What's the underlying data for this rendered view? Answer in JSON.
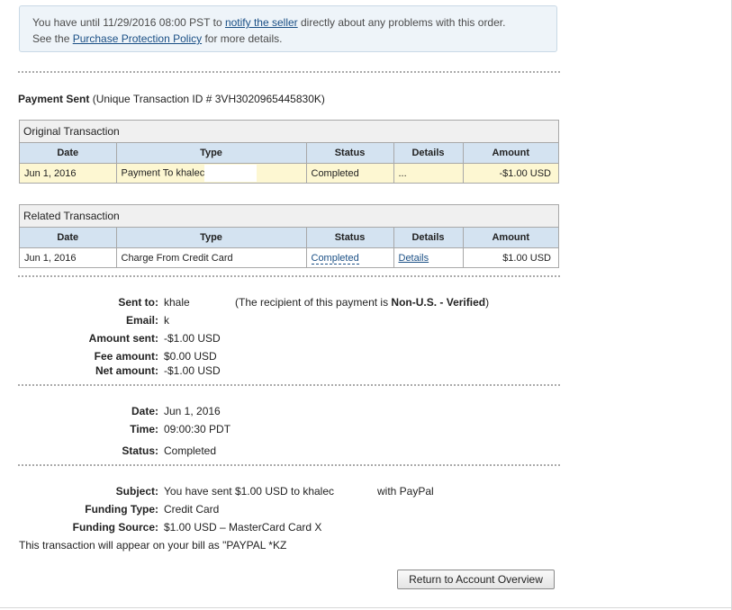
{
  "notice": {
    "line1_before": "You have until 11/29/2016 08:00 PST to ",
    "line1_link": "notify the seller",
    "line1_after": " directly about any problems with this order.",
    "line2_before": "See the ",
    "line2_link": "Purchase Protection Policy",
    "line2_after": " for more details."
  },
  "headline": {
    "title": "Payment Sent",
    "id_text": " (Unique Transaction ID # 3VH3020965445830K)"
  },
  "original": {
    "caption": "Original Transaction",
    "headers": [
      "Date",
      "Type",
      "Status",
      "Details",
      "Amount"
    ],
    "row": {
      "date": "Jun 1, 2016",
      "type": "Payment To khalec",
      "status": "Completed",
      "details": "...",
      "amount": "-$1.00 USD"
    }
  },
  "related": {
    "caption": "Related Transaction",
    "headers": [
      "Date",
      "Type",
      "Status",
      "Details",
      "Amount"
    ],
    "row": {
      "date": "Jun 1, 2016",
      "type": "Charge From Credit Card",
      "status": "Completed",
      "details": "Details",
      "amount": "$1.00 USD"
    }
  },
  "payment": {
    "sent_to_label": "Sent to:",
    "sent_to": "khale",
    "note_before": "(The recipient of this payment is ",
    "note_bold": "Non-U.S. - Verified",
    "note_after": ")",
    "email_label": "Email:",
    "email": "k",
    "amount_label": "Amount sent:",
    "amount": "-$1.00 USD",
    "fee_label": "Fee amount:",
    "fee": "$0.00 USD",
    "net_label": "Net amount:",
    "net": "-$1.00 USD"
  },
  "timing": {
    "date_label": "Date:",
    "date": "Jun 1, 2016",
    "time_label": "Time:",
    "time": "09:00:30 PDT",
    "status_label": "Status:",
    "status": "Completed"
  },
  "funding": {
    "subject_label": "Subject:",
    "subject": "You have sent $1.00 USD to khalec",
    "subject_tail": "with PayPal",
    "type_label": "Funding Type:",
    "type": "Credit Card",
    "source_label": "Funding Source:",
    "source": "$1.00 USD – MasterCard Card X",
    "bill_text": "This transaction will appear on your bill as \"PAYPAL *KZ"
  },
  "button": {
    "label": "Return to Account Overview"
  }
}
